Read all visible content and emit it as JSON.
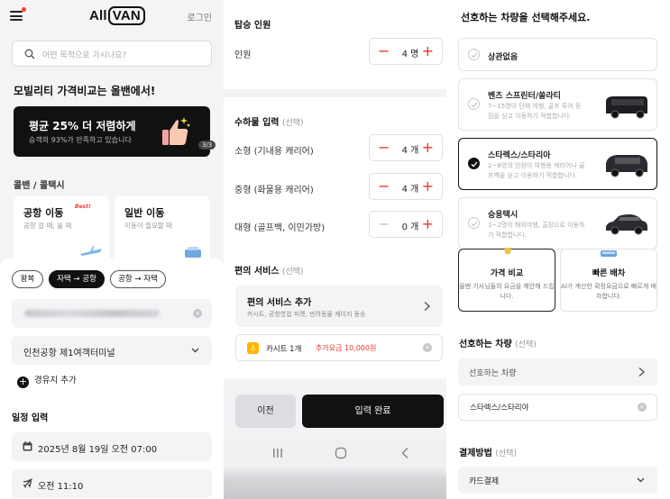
{
  "screen1": {
    "logo_prefix": "All",
    "logo_box": "VAN",
    "login": "로그인",
    "search_placeholder": "어떤 목적으로 가시나요?",
    "headline": "모빌리티 가격비교는 올밴에서!",
    "banner": {
      "title": "평균 25% 더 저렴하게",
      "subtitle": "승객의 93%가 만족하고 있습니다",
      "page": "3/3"
    },
    "section_label": "콜밴 / 콜택시",
    "cards": [
      {
        "title": "공항 이동",
        "badge": "Best!",
        "subtitle": "공항 갈 때, 올 때"
      },
      {
        "title": "일반 이동",
        "subtitle": "이동이 필요할 때"
      }
    ],
    "trip_chips": [
      "왕복",
      "자택 → 공항",
      "공항 → 자택"
    ],
    "active_chip": "자택 → 공항",
    "destination": "인천공항 제1여객터미널",
    "add_stop": "경유지 추가",
    "schedule_title": "일정 입력",
    "date_value": "2025년 8월 19일 오전 07:00",
    "flight_value": "오전 11:10"
  },
  "screen2": {
    "passenger_section": "탑승 인원",
    "passenger_label": "인원",
    "passenger_value": "4 명",
    "luggage_section": "수하물 입력",
    "optional": "(선택)",
    "luggage": [
      {
        "label": "소형 (기내용 캐리어)",
        "value": "4 개",
        "minus_enabled": true
      },
      {
        "label": "중형 (화물용 캐리어)",
        "value": "4 개",
        "minus_enabled": true
      },
      {
        "label": "대형 (골프백, 이민가방)",
        "value": "0 개",
        "minus_enabled": false
      }
    ],
    "service_section": "편의 서비스",
    "service_add_title": "편의 서비스 추가",
    "service_add_desc": "카시트, 공항영접 피켓, 반려동물 케이지 동승",
    "cart_label": "카시트 1개",
    "cart_price": "추가요금 10,000원",
    "prev_button": "이전",
    "done_button": "입력 완료"
  },
  "screen3": {
    "title": "선호하는 차량을 선택해주세요.",
    "vehicles": [
      {
        "name": "상관없음",
        "desc": "",
        "selected": false
      },
      {
        "name": "벤츠 스프린터/쏠라티",
        "desc": "7~15명이 단체 여행, 골프 투어 등 짐을 싣고 이동하기 적합합니다.",
        "selected": false
      },
      {
        "name": "스타렉스/스타리아",
        "desc": "2~8명의 인원이 여행용 캐리어나 골프백을 싣고 이동하기 적합합니다.",
        "selected": true
      },
      {
        "name": "승용택시",
        "desc": "1~2명이 해외여행, 출장으로 이동하기 적합합니다.",
        "selected": false
      }
    ],
    "options": [
      {
        "title": "가격 비교",
        "desc": "올밴 기사님들의 요금을 제안해 드립니다.",
        "selected": true
      },
      {
        "title": "빠른 배차",
        "desc": "AI가 계산한 확정요금으로 빠르게 배차합니다.",
        "selected": false
      }
    ],
    "preferred_section": "선호하는 차량",
    "optional": "(선택)",
    "preferred_placeholder": "선호하는 차량",
    "preferred_value": "스타렉스/스타리아",
    "payment_section": "결제방법",
    "payment_value": "카드결제"
  }
}
